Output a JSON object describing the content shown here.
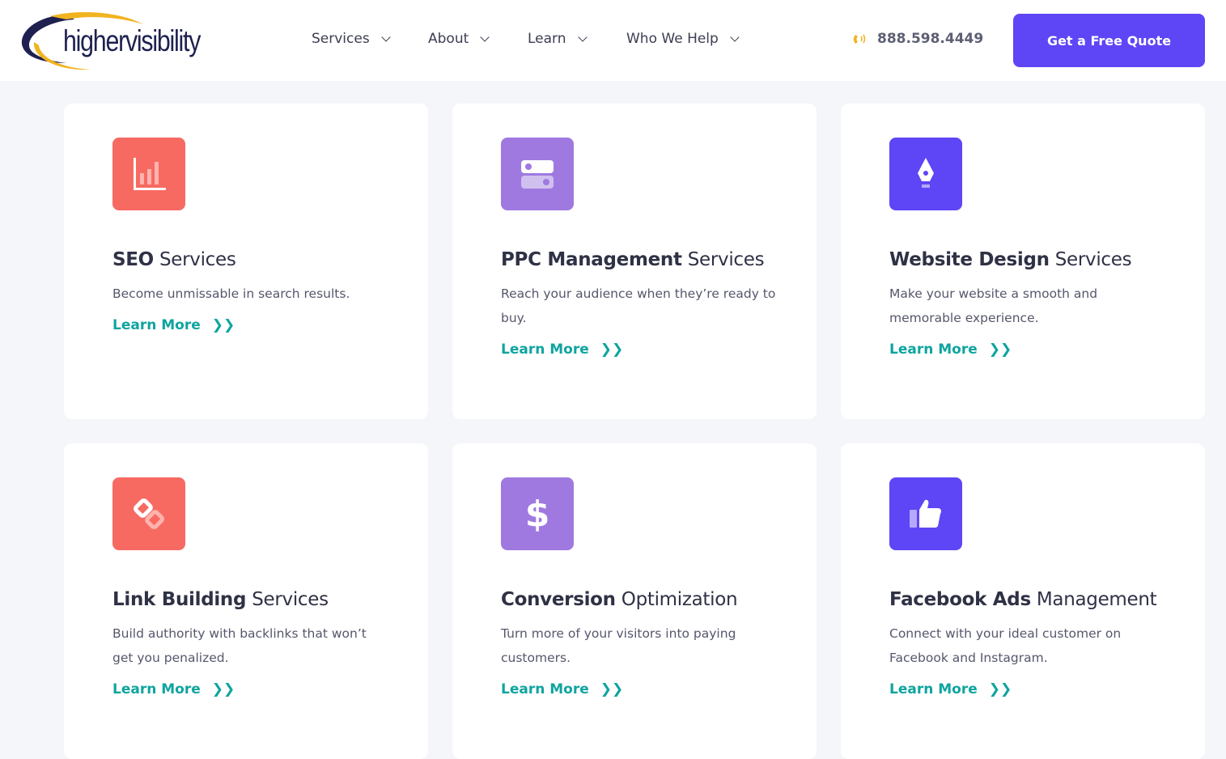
{
  "header": {
    "logo": "highervisibility",
    "nav": [
      {
        "label": "Services"
      },
      {
        "label": "About"
      },
      {
        "label": "Learn"
      },
      {
        "label": "Who We Help"
      }
    ],
    "phone": "888.598.4449",
    "cta": "Get a Free Quote"
  },
  "colors": {
    "coral": "#f76a62",
    "lavender": "#9f79e0",
    "violet": "#5e45f6",
    "teal": "#0fa4a0"
  },
  "cards": [
    {
      "bold": "SEO",
      "rest": " Services",
      "desc": "Become unmissable in search results.",
      "link": "Learn More",
      "icon": "bar-chart-icon"
    },
    {
      "bold": "PPC Management",
      "rest": " Services",
      "desc": "Reach your audience when they’re ready to buy.",
      "link": "Learn More",
      "icon": "toggle-icon"
    },
    {
      "bold": "Website Design",
      "rest": " Services",
      "desc": "Make your website a smooth and memorable experience.",
      "link": "Learn More",
      "icon": "pen-nib-icon"
    },
    {
      "bold": "Link Building",
      "rest": " Services",
      "desc": "Build authority with backlinks that won’t get you penalized.",
      "link": "Learn More",
      "icon": "link-icon"
    },
    {
      "bold": "Conversion",
      "rest": " Optimization",
      "desc": "Turn more of your visitors into paying customers.",
      "link": "Learn More",
      "icon": "dollar-icon"
    },
    {
      "bold": "Facebook Ads",
      "rest": " Management",
      "desc": "Connect with your ideal customer on Facebook and Instagram.",
      "link": "Learn More",
      "icon": "thumbs-up-icon"
    }
  ]
}
